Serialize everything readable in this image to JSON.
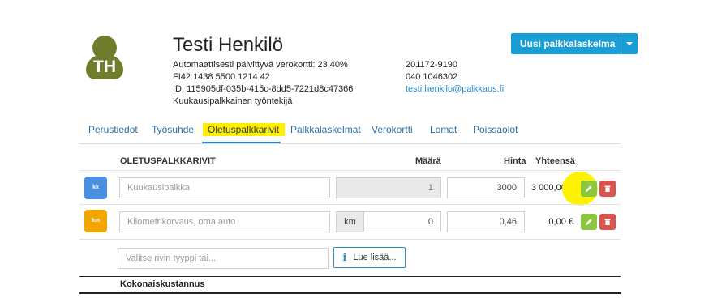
{
  "employee": {
    "initials": "TH",
    "name": "Testi Henkilö",
    "details_left": [
      "Automaattisesti päivittyvä verokortti: 23,40%",
      "FI42 1438 5500 1214 42",
      "ID: 115905df-035b-415c-8dd5-7221d8c47366",
      "Kuukausipalkkainen työntekijä"
    ],
    "details_right": {
      "ssn": "201172-9190",
      "phone": "040 1046302",
      "email": "testi.henkilo@palkkaus.fi"
    }
  },
  "header_button": {
    "label": "Uusi palkkalaskelma"
  },
  "tabs": [
    {
      "label": "Perustiedot"
    },
    {
      "label": "Työsuhde"
    },
    {
      "label": "Oletuspalkkarivit",
      "active": true
    },
    {
      "label": "Palkkalaskelmat"
    },
    {
      "label": "Verokortti"
    },
    {
      "label": "Lomat"
    },
    {
      "label": "Poissaolot"
    }
  ],
  "table": {
    "columns": {
      "description": "OLETUSPALKKARIVIT",
      "quantity": "Määrä",
      "price": "Hinta",
      "total": "Yhteensä"
    },
    "rows": [
      {
        "badge": "kk",
        "badge_color": "#4a90e2",
        "description_placeholder": "Kuukausipalkka",
        "unit": "",
        "quantity": "1",
        "price": "3000",
        "total": "3 000,00 €"
      },
      {
        "badge": "km",
        "badge_color": "#f5a500",
        "description_placeholder": "Kilometrikorvaus, oma auto",
        "unit": "km",
        "quantity": "0",
        "price": "0,46",
        "total": "0,00 €"
      }
    ],
    "add_row_placeholder": "Valitse rivin tyyppi tai...",
    "read_more_label": "Lue lisää...",
    "footer_label": "Kokonaiskustannus"
  },
  "colors": {
    "accent": "#1a9ed8",
    "edit": "#8cc63f",
    "delete": "#d9534f",
    "avatar": "#6f7d2c",
    "highlight": "#ffee00"
  },
  "icons": [
    "user-avatar-icon",
    "caret-down-icon",
    "pencil-icon",
    "trash-icon",
    "info-icon"
  ]
}
